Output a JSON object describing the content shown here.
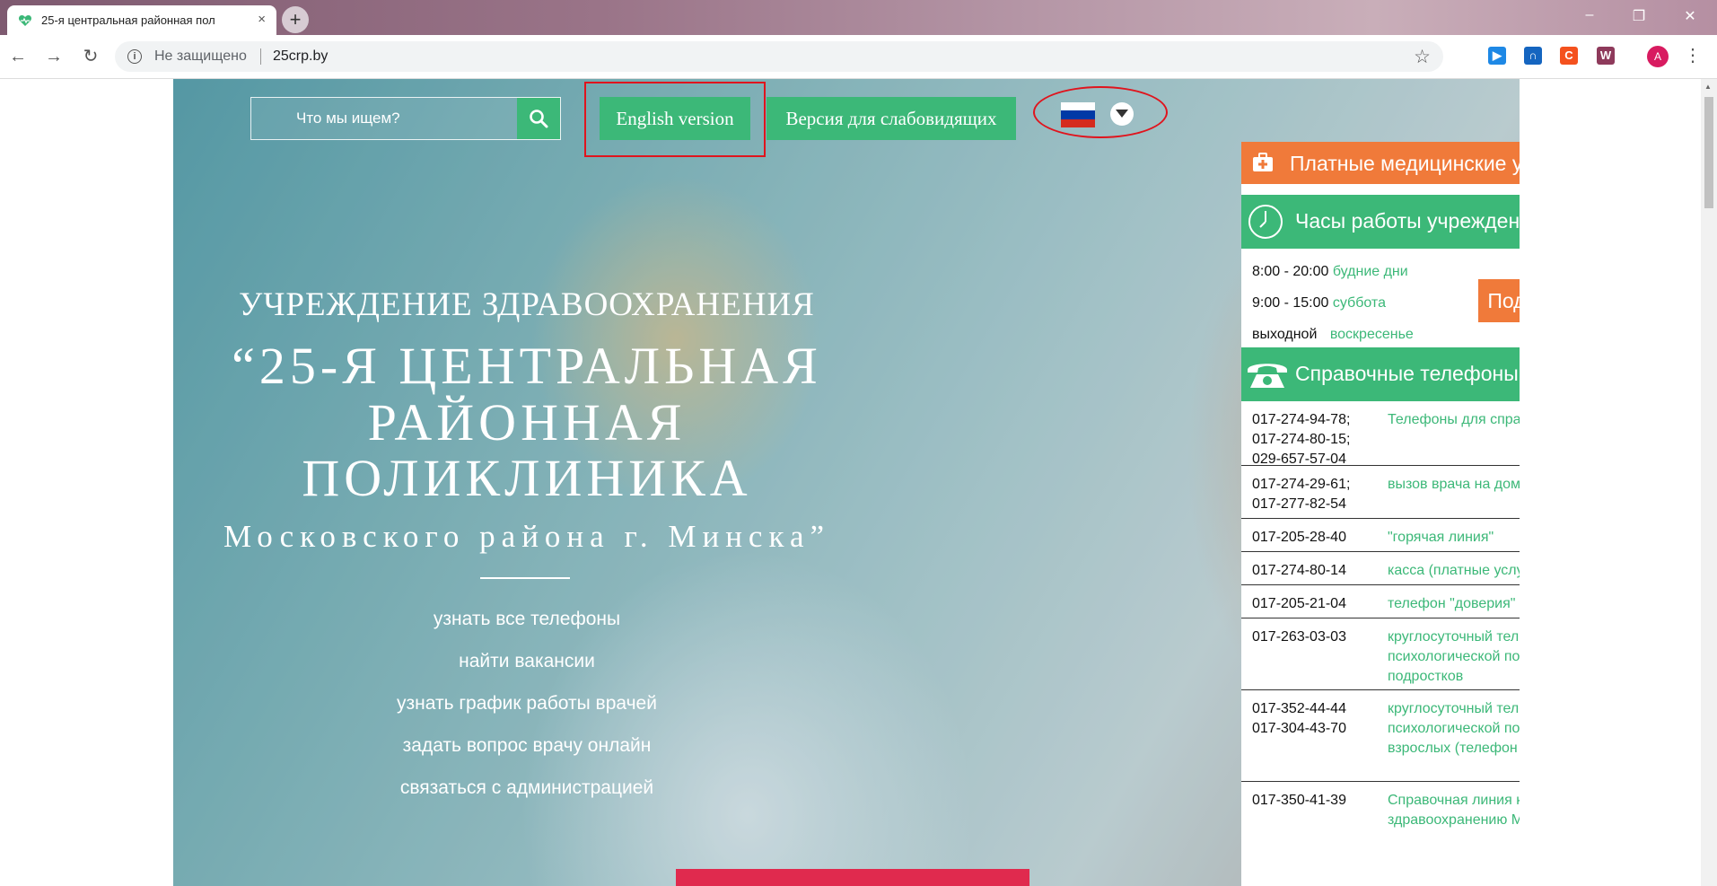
{
  "browser": {
    "tab_title": "25-я центральная районная пол",
    "tab_close": "×",
    "new_tab": "+",
    "security_label": "Не защищено",
    "url": "25crp.by",
    "profile_initial": "A",
    "extensions": [
      {
        "name": "Google Play Movies",
        "glyph": "▶",
        "color": "#1e88e5"
      },
      {
        "name": "extension",
        "glyph": "∩",
        "color": "#1565c0"
      },
      {
        "name": "extension",
        "glyph": "C",
        "color": "#f4511e"
      },
      {
        "name": "extension",
        "glyph": "W",
        "color": "#8e3a5b"
      }
    ]
  },
  "header": {
    "search_placeholder": "Что мы ищем?",
    "english_label": "English version",
    "lowvision_label": "Версия для слабовидящих",
    "language": "ru"
  },
  "hero": {
    "line1": "УЧРЕЖДЕНИЕ ЗДРАВООХРАНЕНИЯ",
    "line2": "“25-Я ЦЕНТРАЛЬНАЯ",
    "line3": "РАЙОННАЯ",
    "line4": "ПОЛИКЛИНИКА",
    "line5": "Московского района г. Минска”",
    "links": [
      "узнать все телефоны",
      "найти вакансии",
      "узнать график работы врачей",
      "задать вопрос врачу онлайн",
      "связаться с администрацией"
    ]
  },
  "sidebar": {
    "paid_services": "Платные медицинские услуги",
    "hours_title": "Часы работы учреждения",
    "hours": [
      {
        "time": "8:00 - 20:00",
        "day": "будние дни"
      },
      {
        "time": "9:00 - 15:00",
        "day": "суббота"
      },
      {
        "time": "выходной",
        "day": "воскресенье"
      }
    ],
    "more_label": "Подробнее",
    "phones_title": "Справочные телефоны",
    "phones": [
      {
        "numbers": "017-274-94-78;\n017-274-80-15;\n029-657-57-04",
        "desc": "Телефоны для справок"
      },
      {
        "numbers": "017-274-29-61;\n017-277-82-54",
        "desc": "вызов врача на дом"
      },
      {
        "numbers": "017-205-28-40",
        "desc": "\"горячая линия\""
      },
      {
        "numbers": "017-274-80-14",
        "desc": "касса (платные услуги)"
      },
      {
        "numbers": "017-205-21-04",
        "desc": "телефон \"доверия\""
      },
      {
        "numbers": "017-263-03-03",
        "desc": "круглосуточный телефон экстренной психологической помощи для детей и подростков"
      },
      {
        "numbers": "017-352-44-44\n017-304-43-70",
        "desc": "круглосуточный телефон экстренной психологической помощи для взрослых (телефон доверия)"
      },
      {
        "numbers": "017-350-41-39",
        "desc": "Справочная линия комитета по здравоохранению Мингорисполкома"
      }
    ]
  },
  "colors": {
    "green": "#3cb878",
    "orange": "#f07a3a",
    "highlight_red": "#e0141d",
    "promo_red": "#e02a4e"
  }
}
